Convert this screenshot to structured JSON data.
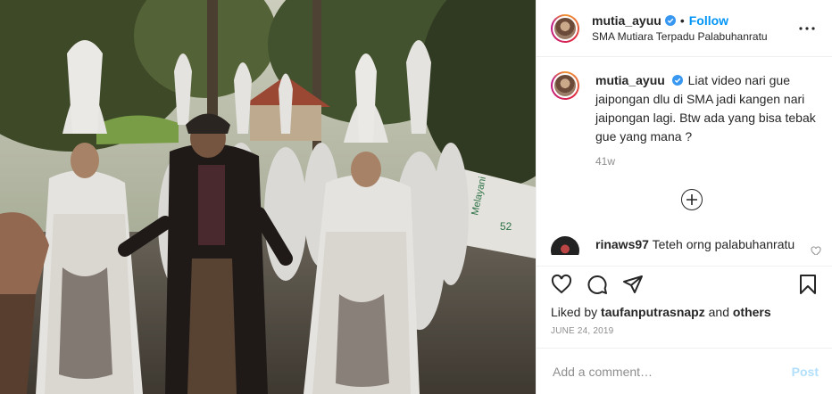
{
  "header": {
    "username": "mutia_ayuu",
    "separator": "•",
    "follow_label": "Follow",
    "location": "SMA Mutiara Terpadu Palabuhanratu",
    "more_icon": "more-horizontal-icon"
  },
  "caption": {
    "username": "mutia_ayuu",
    "text": "Liat video nari gue jaipongan dlu di SMA jadi kangen nari jaipongan lagi. Btw ada yang bisa tebak gue yang mana ?",
    "time": "41w"
  },
  "load_more_icon": "plus-circle-icon",
  "comment": {
    "username": "rinaws97",
    "text": "Teteh orng palabuhanratu"
  },
  "actions": {
    "like_icon": "heart-icon",
    "comment_icon": "comment-icon",
    "share_icon": "share-icon",
    "save_icon": "bookmark-icon"
  },
  "likes": {
    "prefix": "Liked by",
    "user": "taufanputrasnapz",
    "joiner": "and",
    "others": "others"
  },
  "date": "JUNE 24, 2019",
  "add_comment": {
    "placeholder": "Add a comment…",
    "post_label": "Post"
  },
  "photo": {
    "banner_text": "Melayani",
    "banner_number": "52"
  },
  "colors": {
    "accent": "#0095f6",
    "post_disabled": "#b2dffc",
    "muted": "#8e8e8e",
    "border": "#efefef"
  }
}
